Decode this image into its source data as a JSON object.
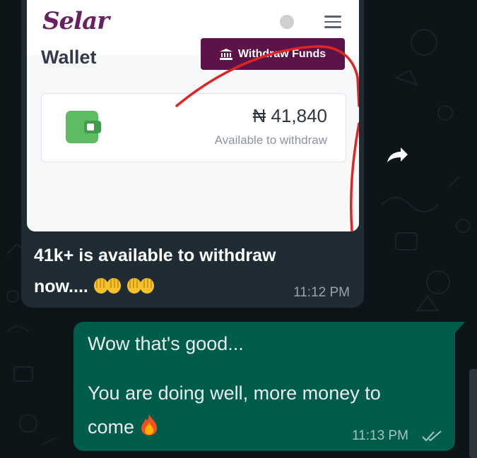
{
  "screenshot": {
    "brand": "Selar",
    "wallet_title": "Wallet",
    "withdraw_button": "Withdraw Funds",
    "balance": "₦ 41,840",
    "balance_caption": "Available to withdraw"
  },
  "incoming_message": {
    "line1": "41k+ is available to withdraw",
    "line2": "now....",
    "time": "11:12 PM"
  },
  "outgoing_message": {
    "line1": "Wow that's good...",
    "line2": "You are doing well, more money to",
    "line3": "come",
    "time": "11:13 PM",
    "status_icon": "double-check-icon"
  },
  "colors": {
    "chat_bg": "#0d1518",
    "incoming_bubble": "#1f2c33",
    "outgoing_bubble": "#005c4b",
    "selar_purple": "#5c1448",
    "wallet_green": "#5dbb63",
    "annotation_red": "#e02424"
  }
}
